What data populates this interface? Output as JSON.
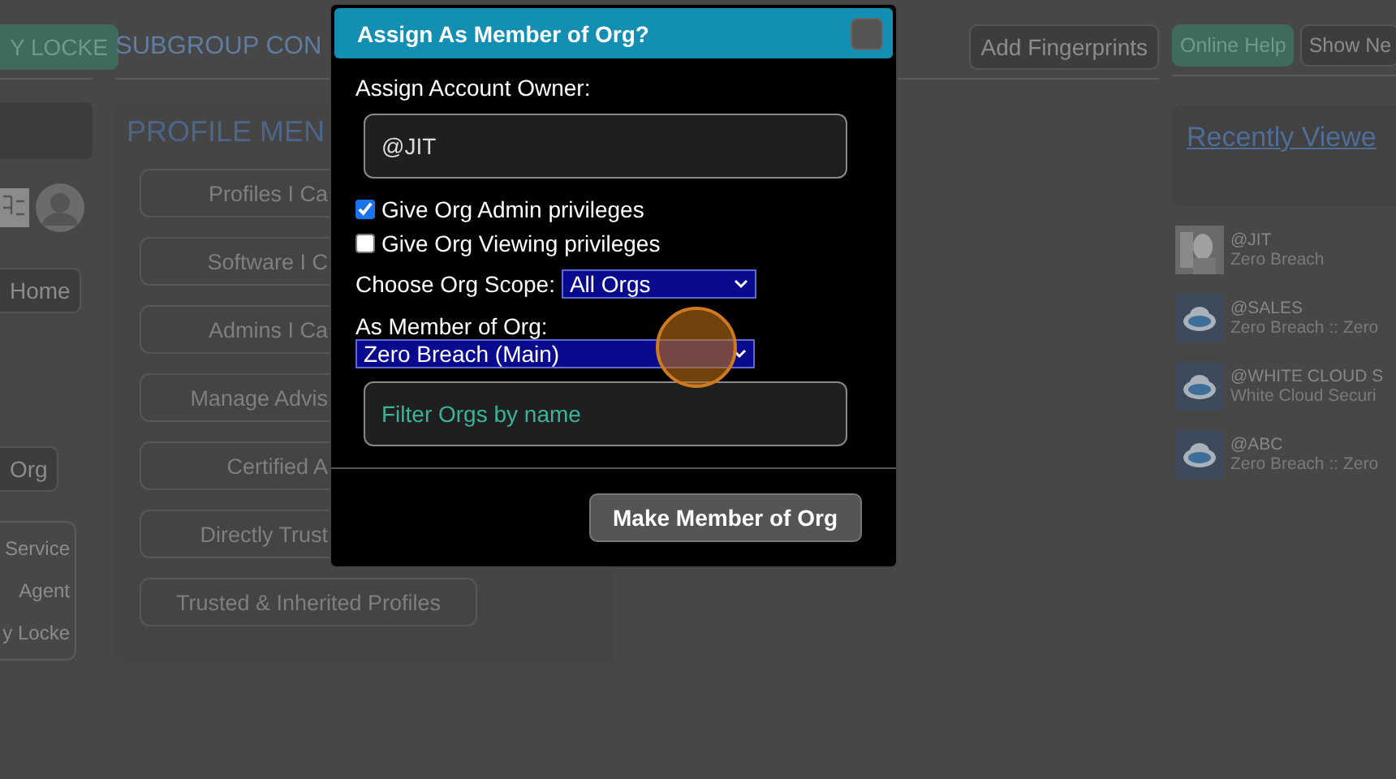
{
  "left_column": {
    "top_button": "Y LOCKE",
    "home_button": "Home",
    "org_button": "Org",
    "agent_box": [
      "Service",
      "Agent",
      "y Locke"
    ]
  },
  "header": {
    "title": "SUBGROUP CON",
    "buttons": [
      {
        "label": "Add Fingerprints",
        "kind": "plain"
      },
      {
        "label": "Online Help",
        "kind": "accent"
      },
      {
        "label": "Show Ne",
        "kind": "plain"
      }
    ]
  },
  "profile_menu": {
    "title": "PROFILE MEN",
    "items": [
      {
        "label": "Profiles I Ca",
        "kind": "covered"
      },
      {
        "label": "Software I C",
        "kind": "covered"
      },
      {
        "label": "Admins I Ca",
        "kind": "covered"
      },
      {
        "label": "Manage Advis",
        "kind": "covered"
      },
      {
        "label": "Certified A",
        "kind": "covered"
      },
      {
        "label": "Directly Trust",
        "kind": "covered"
      },
      {
        "label": "Trusted & Inherited Profiles",
        "kind": "full"
      }
    ]
  },
  "recently_viewed": {
    "title": "Recently Viewe",
    "items": [
      {
        "handle": "@JIT",
        "org": "Zero Breach",
        "kind": "picture"
      },
      {
        "handle": "@SALES",
        "org": "Zero Breach :: Zero",
        "kind": "cloud"
      },
      {
        "handle": "@WHITE CLOUD S",
        "org": "White Cloud Securi",
        "kind": "cloud"
      },
      {
        "handle": "@ABC",
        "org": "Zero Breach :: Zero",
        "kind": "cloud"
      }
    ]
  },
  "dialog": {
    "title": "Assign As Member of Org?",
    "owner_label": "Assign Account Owner:",
    "owner_value": "@JIT",
    "checkboxes": [
      {
        "label": "Give Org Admin privileges",
        "checked": true
      },
      {
        "label": "Give Org Viewing privileges",
        "checked": false
      }
    ],
    "scope_label": "Choose Org Scope:",
    "scope_value": "All Orgs",
    "member_label": "As Member of Org:",
    "member_value": "Zero Breach (Main)",
    "filter_placeholder": "Filter Orgs by name",
    "submit_button": "Make Member of Org"
  }
}
